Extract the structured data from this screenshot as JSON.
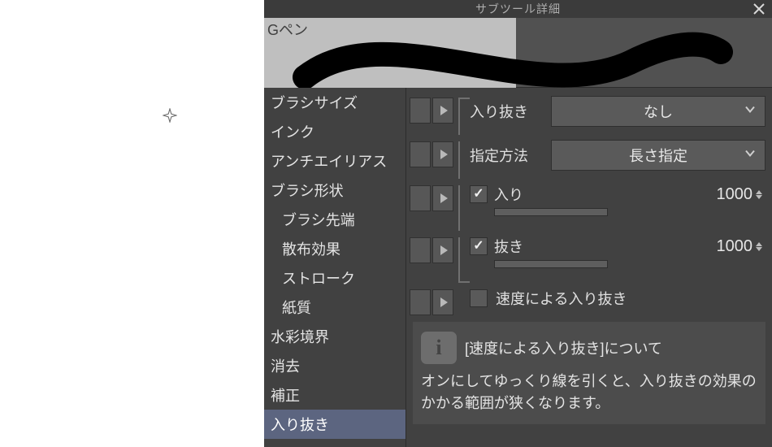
{
  "panel": {
    "title": "サブツール詳細",
    "brush_name": "Gペン"
  },
  "sidebar": {
    "items": [
      {
        "label": "ブラシサイズ",
        "indent": false
      },
      {
        "label": "インク",
        "indent": false
      },
      {
        "label": "アンチエイリアス",
        "indent": false
      },
      {
        "label": "ブラシ形状",
        "indent": false
      },
      {
        "label": "ブラシ先端",
        "indent": true
      },
      {
        "label": "散布効果",
        "indent": true
      },
      {
        "label": "ストローク",
        "indent": true
      },
      {
        "label": "紙質",
        "indent": true
      },
      {
        "label": "水彩境界",
        "indent": false
      },
      {
        "label": "消去",
        "indent": false
      },
      {
        "label": "補正",
        "indent": false
      },
      {
        "label": "入り抜き",
        "indent": false,
        "selected": true
      }
    ]
  },
  "settings": {
    "inout_label": "入り抜き",
    "inout_value": "なし",
    "method_label": "指定方法",
    "method_value": "長さ指定",
    "iri_label": "入り",
    "iri_value": "1000",
    "nuki_label": "抜き",
    "nuki_value": "1000",
    "speed_label": "速度による入り抜き"
  },
  "info": {
    "icon_letter": "i",
    "title": "[速度による入り抜き]について",
    "body": "オンにしてゆっくり線を引くと、入り抜きの効果のかかる範囲が狭くなります。"
  }
}
